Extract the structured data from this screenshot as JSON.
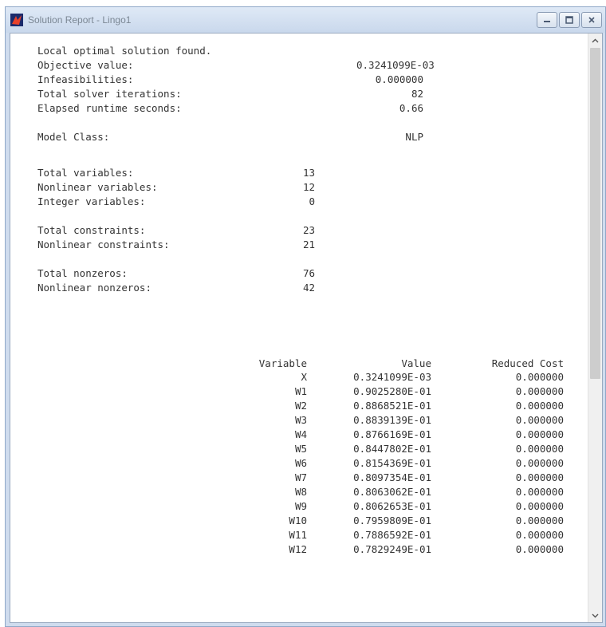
{
  "window": {
    "title": "Solution Report - Lingo1"
  },
  "summary": [
    {
      "label": "Local optimal solution found.",
      "value": ""
    },
    {
      "label": "Objective value:",
      "value": "0.3241099E-03"
    },
    {
      "label": "Infeasibilities:",
      "value": "0.000000"
    },
    {
      "label": "Total solver iterations:",
      "value": "82"
    },
    {
      "label": "Elapsed runtime seconds:",
      "value": "0.66"
    },
    {
      "label": "Model Class:",
      "value": "NLP"
    }
  ],
  "stats": [
    {
      "label": "Total variables:",
      "value": "13"
    },
    {
      "label": "Nonlinear variables:",
      "value": "12"
    },
    {
      "label": "Integer variables:",
      "value": "0"
    },
    {
      "label": "Total constraints:",
      "value": "23"
    },
    {
      "label": "Nonlinear constraints:",
      "value": "21"
    },
    {
      "label": "Total nonzeros:",
      "value": "76"
    },
    {
      "label": "Nonlinear nonzeros:",
      "value": "42"
    }
  ],
  "table": {
    "headers": [
      "Variable",
      "Value",
      "Reduced Cost"
    ],
    "rows": [
      [
        "X",
        "0.3241099E-03",
        "0.000000"
      ],
      [
        "W1",
        "0.9025280E-01",
        "0.000000"
      ],
      [
        "W2",
        "0.8868521E-01",
        "0.000000"
      ],
      [
        "W3",
        "0.8839139E-01",
        "0.000000"
      ],
      [
        "W4",
        "0.8766169E-01",
        "0.000000"
      ],
      [
        "W5",
        "0.8447802E-01",
        "0.000000"
      ],
      [
        "W6",
        "0.8154369E-01",
        "0.000000"
      ],
      [
        "W7",
        "0.8097354E-01",
        "0.000000"
      ],
      [
        "W8",
        "0.8063062E-01",
        "0.000000"
      ],
      [
        "W9",
        "0.8062653E-01",
        "0.000000"
      ],
      [
        "W10",
        "0.7959809E-01",
        "0.000000"
      ],
      [
        "W11",
        "0.7886592E-01",
        "0.000000"
      ],
      [
        "W12",
        "0.7829249E-01",
        "0.000000"
      ]
    ]
  },
  "icons": {
    "app": "lingo-app-icon",
    "minimize": "minimize-icon",
    "maximize": "maximize-icon",
    "close": "close-icon"
  }
}
